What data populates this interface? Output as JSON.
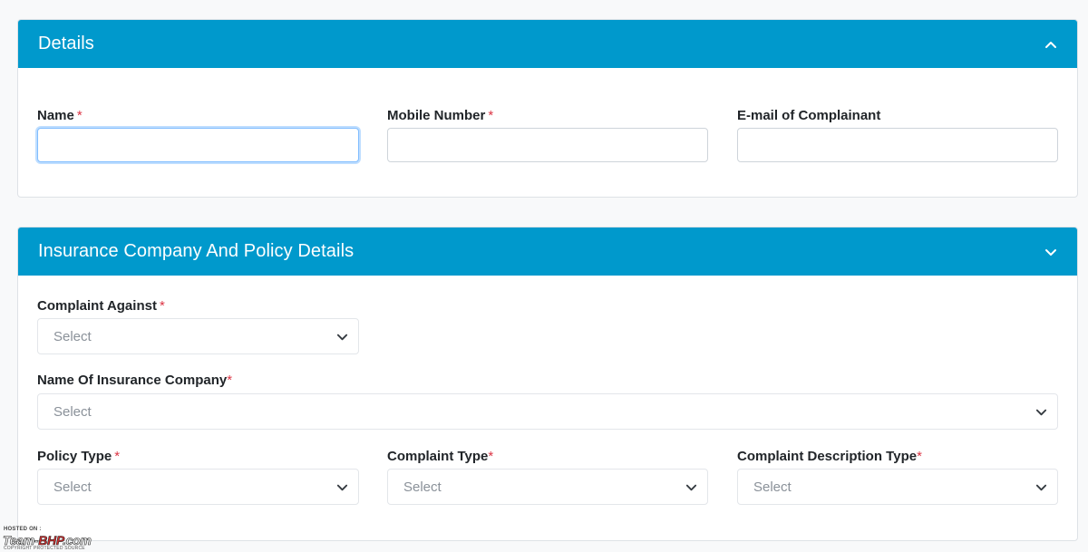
{
  "details": {
    "title": "Details",
    "fields": {
      "name": {
        "label": "Name",
        "required": "*",
        "value": ""
      },
      "mobile": {
        "label": "Mobile Number",
        "required": "*",
        "value": ""
      },
      "email": {
        "label": "E-mail of Complainant",
        "value": ""
      }
    }
  },
  "insurance": {
    "title": "Insurance Company And Policy Details",
    "fields": {
      "complaint_against": {
        "label": "Complaint Against",
        "required": "*",
        "value": "Select"
      },
      "insurance_company": {
        "label": "Name Of Insurance Company",
        "required": "*",
        "value": "Select"
      },
      "policy_type": {
        "label": "Policy Type",
        "required": "*",
        "value": "Select"
      },
      "complaint_type": {
        "label": "Complaint Type",
        "required": "*",
        "value": "Select"
      },
      "complaint_description_type": {
        "label": "Complaint Description Type",
        "required": "*",
        "value": "Select"
      }
    }
  },
  "watermark": {
    "hosted_on": "HOSTED ON :",
    "brand_part1": "Team-",
    "brand_part2": "BHP",
    "brand_part3": ".com",
    "copyright": "COPYRIGHT PROTECTED SOURCE"
  },
  "colors": {
    "header_bg": "#0099cc",
    "required": "#dc3545",
    "focus_border": "#80bdff"
  },
  "icons": {
    "details_toggle": "chevron-up-icon",
    "insurance_toggle": "chevron-down-icon",
    "select_caret": "chevron-down-icon"
  }
}
